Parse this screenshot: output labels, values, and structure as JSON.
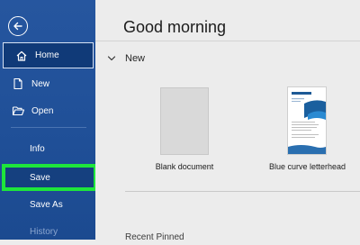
{
  "sidebar": {
    "back_icon": "back-arrow-icon",
    "items": {
      "home": {
        "label": "Home",
        "icon": "home-icon"
      },
      "new": {
        "label": "New",
        "icon": "new-document-icon"
      },
      "open": {
        "label": "Open",
        "icon": "folder-open-icon"
      },
      "info": {
        "label": "Info"
      },
      "save": {
        "label": "Save"
      },
      "save_as": {
        "label": "Save As"
      },
      "history": {
        "label": "History"
      }
    },
    "colors": {
      "background": "#26569f",
      "selected": "#103a78",
      "highlight_border": "#1ee63b"
    }
  },
  "main": {
    "greeting": "Good morning",
    "new_section": {
      "title": "New",
      "icon": "chevron-down-icon"
    },
    "templates": [
      {
        "label": "Blank document"
      },
      {
        "label": "Blue curve letterhead"
      }
    ],
    "cut_off_text": "Recent   Pinned"
  }
}
